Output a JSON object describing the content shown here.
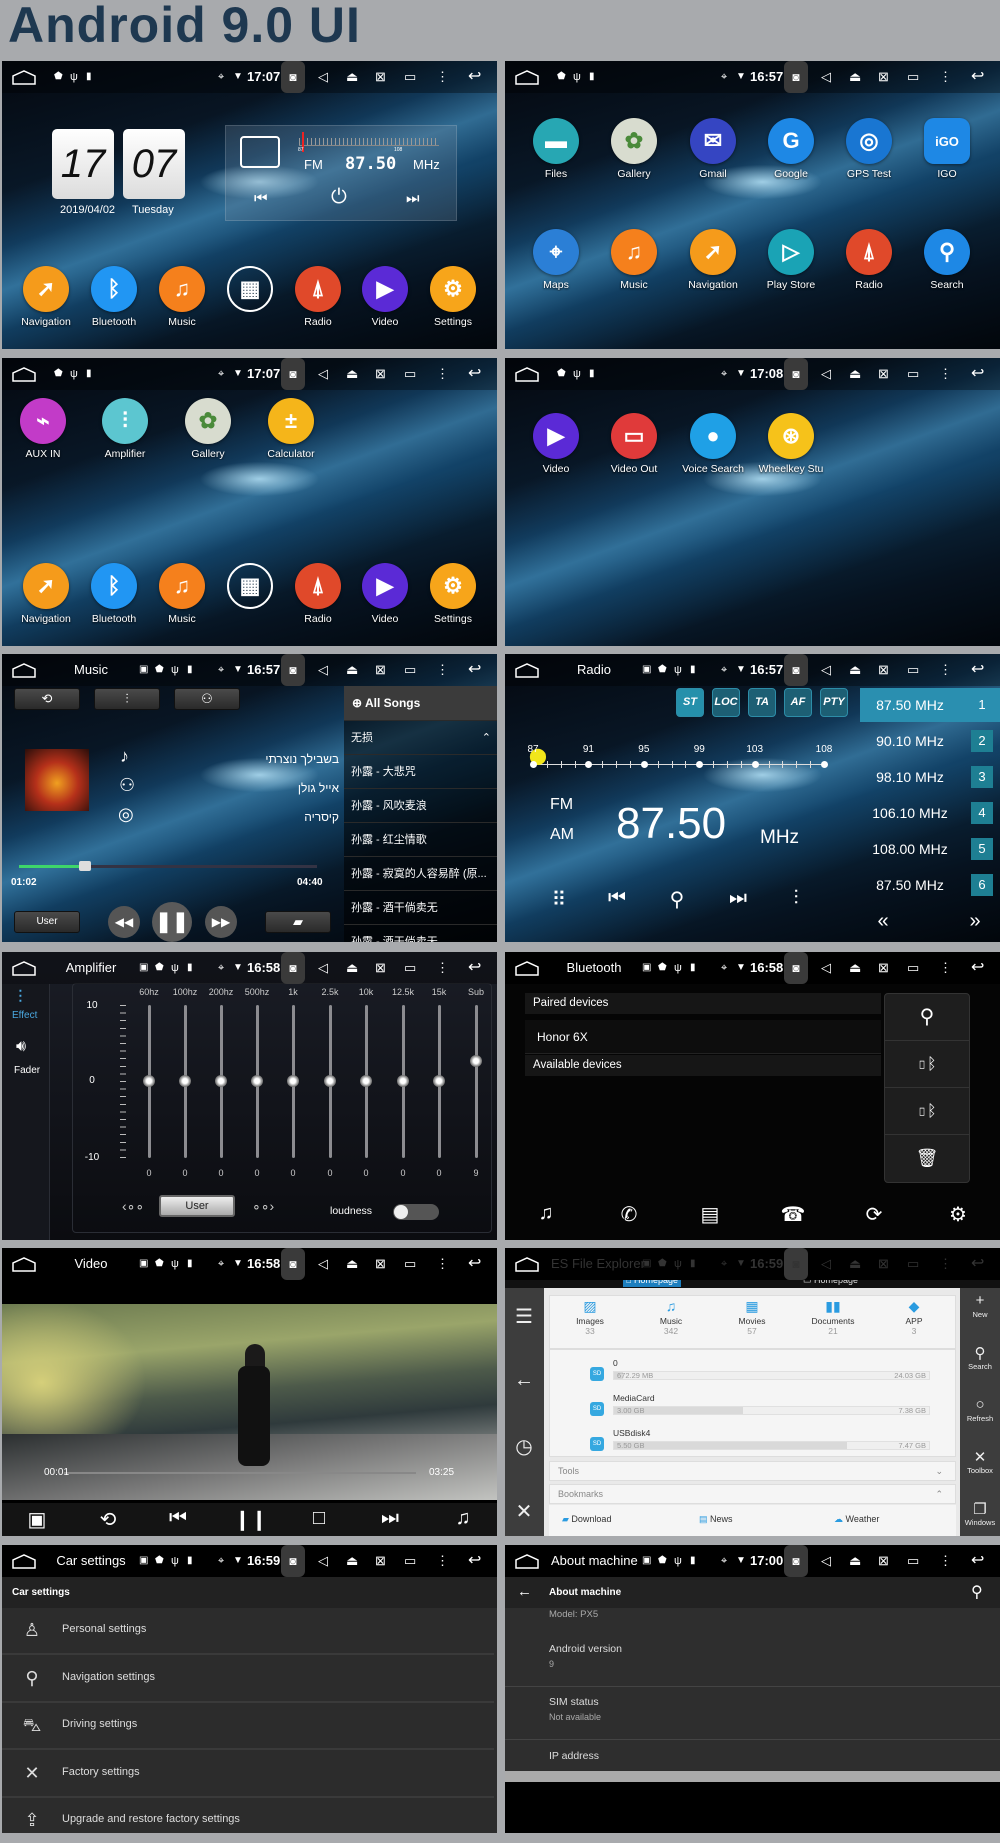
{
  "header": {
    "title": "Android 9.0 UI"
  },
  "status_icons": [
    "home",
    "image",
    "shield",
    "usb",
    "sd-card",
    "location",
    "wifi",
    "camera",
    "volume",
    "eject",
    "screenshot",
    "recent-apps",
    "more",
    "back"
  ],
  "screens": {
    "home": {
      "status": {
        "title": "",
        "time": "17:07"
      },
      "clock": {
        "hours": "17",
        "minutes": "07",
        "date": "2019/04/02",
        "weekday": "Tuesday"
      },
      "radio_widget": {
        "band": "FM",
        "frequency": "87.50",
        "unit": "MHz",
        "scale_min": "87",
        "scale_max": "108"
      },
      "dock": [
        {
          "label": "Navigation",
          "icon": "navigation",
          "color": "#f59b1b"
        },
        {
          "label": "Bluetooth",
          "icon": "bluetooth",
          "color": "#2196f3"
        },
        {
          "label": "Music",
          "icon": "music",
          "color": "#f5801c"
        },
        {
          "label": "",
          "icon": "apps-grid",
          "color": "transparent"
        },
        {
          "label": "Radio",
          "icon": "radio",
          "color": "#e0492a"
        },
        {
          "label": "Video",
          "icon": "video",
          "color": "#5b2ad6"
        },
        {
          "label": "Settings",
          "icon": "settings",
          "color": "#f7a51a"
        }
      ]
    },
    "apps_page_1": {
      "status": {
        "title": "",
        "time": "16:57"
      },
      "apps": [
        {
          "label": "Files",
          "icon": "files",
          "color": "#27a7b3"
        },
        {
          "label": "Gallery",
          "icon": "gallery",
          "color": "#d8dccf"
        },
        {
          "label": "Gmail",
          "icon": "gmail",
          "color": "#3545c2"
        },
        {
          "label": "Google",
          "icon": "google",
          "color": "#1e88e5"
        },
        {
          "label": "GPS Test",
          "icon": "gps",
          "color": "#1976d2"
        },
        {
          "label": "IGO",
          "icon": "igo",
          "color": "#1e88e5"
        },
        {
          "label": "Maps",
          "icon": "maps",
          "color": "#2b7fd6"
        },
        {
          "label": "Music",
          "icon": "music",
          "color": "#f5801c"
        },
        {
          "label": "Navigation",
          "icon": "navigation",
          "color": "#f59b1b"
        },
        {
          "label": "Play Store",
          "icon": "play-store",
          "color": "#1aa3b5"
        },
        {
          "label": "Radio",
          "icon": "radio",
          "color": "#e0492a"
        },
        {
          "label": "Search",
          "icon": "search",
          "color": "#1e88e5"
        }
      ]
    },
    "apps_page_2": {
      "status": {
        "title": "",
        "time": "17:07"
      },
      "apps": [
        {
          "label": "AUX IN",
          "icon": "aux",
          "color": "#c23bc8"
        },
        {
          "label": "Amplifier",
          "icon": "equalizer",
          "color": "#5cc6d0"
        },
        {
          "label": "Gallery",
          "icon": "gallery",
          "color": "#d8dccf"
        },
        {
          "label": "Calculator",
          "icon": "calculator",
          "color": "#f5b51a"
        }
      ],
      "dock": [
        {
          "label": "Navigation",
          "icon": "navigation",
          "color": "#f59b1b"
        },
        {
          "label": "Bluetooth",
          "icon": "bluetooth",
          "color": "#2196f3"
        },
        {
          "label": "Music",
          "icon": "music",
          "color": "#f5801c"
        },
        {
          "label": "",
          "icon": "apps-grid",
          "color": "transparent"
        },
        {
          "label": "Radio",
          "icon": "radio",
          "color": "#e0492a"
        },
        {
          "label": "Video",
          "icon": "video",
          "color": "#5b2ad6"
        },
        {
          "label": "Settings",
          "icon": "settings",
          "color": "#f7a51a"
        }
      ]
    },
    "apps_page_3": {
      "status": {
        "title": "",
        "time": "17:08"
      },
      "apps": [
        {
          "label": "Video",
          "icon": "video",
          "color": "#5b2ad6"
        },
        {
          "label": "Video Out",
          "icon": "video-out",
          "color": "#e03a3a"
        },
        {
          "label": "Voice Search",
          "icon": "microphone",
          "color": "#1fa0e6"
        },
        {
          "label": "Wheelkey Stu",
          "icon": "steering-wheel",
          "color": "#f6c21a"
        }
      ]
    },
    "music": {
      "status": {
        "title": "Music",
        "time": "16:57"
      },
      "song": "בשבילך נוצרתי",
      "artist": "אייל גולן",
      "album": "קיסריה",
      "elapsed": "01:02",
      "duration": "04:40",
      "progress": 0.22,
      "user_label": "User",
      "playlist": {
        "header": "All Songs",
        "group": "无损",
        "songs": [
          "孙露 - 大悲咒",
          "孙露 - 风吹麦浪",
          "孙露 - 红尘情歌",
          "孙露 - 寂寞的人容易醉 (原...",
          "孙露 - 酒干倘卖无",
          "孙露 - 酒干倘卖无"
        ]
      }
    },
    "radio": {
      "status": {
        "title": "Radio",
        "time": "16:57"
      },
      "toggles": [
        "ST",
        "LOC",
        "TA",
        "AF",
        "PTY"
      ],
      "scale_labels": [
        "87",
        "91",
        "95",
        "99",
        "103",
        "108"
      ],
      "bands": [
        "FM",
        "AM"
      ],
      "active_band": "FM",
      "frequency": "87.50",
      "unit": "MHz",
      "presets": [
        {
          "freq": "87.50 MHz",
          "num": "1",
          "selected": true
        },
        {
          "freq": "90.10 MHz",
          "num": "2"
        },
        {
          "freq": "98.10 MHz",
          "num": "3"
        },
        {
          "freq": "106.10 MHz",
          "num": "4"
        },
        {
          "freq": "108.00 MHz",
          "num": "5"
        },
        {
          "freq": "87.50 MHz",
          "num": "6"
        }
      ]
    },
    "amplifier": {
      "status": {
        "title": "Amplifier",
        "time": "16:58"
      },
      "tabs": [
        {
          "label": "Effect",
          "active": true
        },
        {
          "label": "Fader",
          "active": false
        }
      ],
      "scale": [
        "10",
        "0",
        "-10"
      ],
      "bands": [
        {
          "label": "60hz",
          "value": 0
        },
        {
          "label": "100hz",
          "value": 0
        },
        {
          "label": "200hz",
          "value": 0
        },
        {
          "label": "500hz",
          "value": 0
        },
        {
          "label": "1k",
          "value": 0
        },
        {
          "label": "2.5k",
          "value": 0
        },
        {
          "label": "10k",
          "value": 0
        },
        {
          "label": "12.5k",
          "value": 0
        },
        {
          "label": "15k",
          "value": 0
        },
        {
          "label": "Sub",
          "value": 9
        }
      ],
      "preset": "User",
      "loudness_label": "loudness",
      "loudness_on": false
    },
    "bluetooth": {
      "status": {
        "title": "Bluetooth",
        "time": "16:58"
      },
      "paired_header": "Paired devices",
      "paired": [
        "Honor 6X"
      ],
      "available_header": "Available devices"
    },
    "video": {
      "status": {
        "title": "Video",
        "time": "16:58"
      },
      "elapsed": "00:01",
      "duration": "03:25",
      "progress": 0.005
    },
    "file_explorer": {
      "status": {
        "title": "ES File Explorer",
        "time": "16:59"
      },
      "tabs": [
        "Homepage",
        "Homepage"
      ],
      "categories": [
        {
          "label": "Images",
          "count": "33"
        },
        {
          "label": "Music",
          "count": "342"
        },
        {
          "label": "Movies",
          "count": "57"
        },
        {
          "label": "Documents",
          "count": "21"
        },
        {
          "label": "APP",
          "count": "3"
        }
      ],
      "storage": [
        {
          "name": "0",
          "used": "672.29 MB",
          "total": "24.03 GB",
          "fraction": 0.03
        },
        {
          "name": "MediaCard",
          "used": "3.00 GB",
          "total": "7.38 GB",
          "fraction": 0.41
        },
        {
          "name": "USBdisk4",
          "used": "5.50 GB",
          "total": "7.47 GB",
          "fraction": 0.74
        }
      ],
      "tools_label": "Tools",
      "bookmarks_label": "Bookmarks",
      "bookmarks": [
        "Download",
        "News",
        "Weather"
      ],
      "right_actions": [
        "New",
        "Search",
        "Refresh",
        "Toolbox",
        "Windows"
      ]
    },
    "car_settings": {
      "status": {
        "title": "Car settings",
        "time": "16:59"
      },
      "header": "Car settings",
      "items": [
        {
          "label": "Personal settings",
          "icon": "person"
        },
        {
          "label": "Navigation settings",
          "icon": "navigation-pin"
        },
        {
          "label": "Driving settings",
          "icon": "car"
        },
        {
          "label": "Factory settings",
          "icon": "tools"
        },
        {
          "label": "Upgrade and restore factory settings",
          "icon": "upgrade"
        }
      ]
    },
    "about": {
      "status": {
        "title": "About machine",
        "time": "17:00"
      },
      "header": "About machine",
      "model": "Model: PX5",
      "rows": [
        {
          "title": "Android version",
          "value": "9"
        },
        {
          "title": "SIM status",
          "value": "Not available"
        },
        {
          "title": "IP address",
          "value": ""
        }
      ]
    }
  }
}
